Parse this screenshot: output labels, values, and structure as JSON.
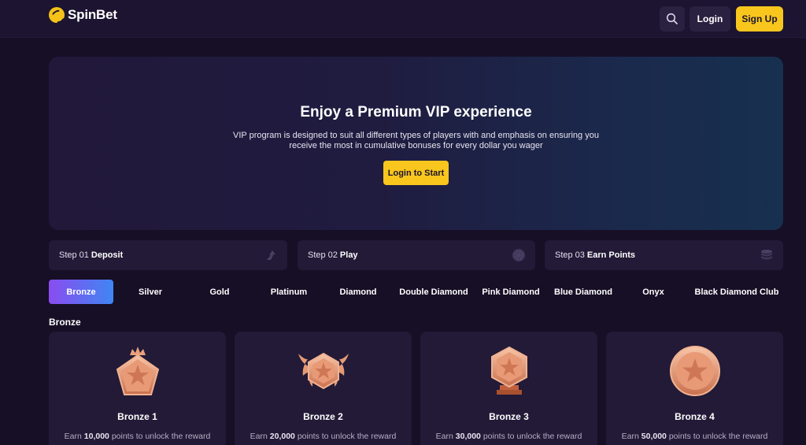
{
  "header": {
    "brand": "SpinBet",
    "login_label": "Login",
    "signup_label": "Sign Up",
    "search_icon": "search-icon"
  },
  "hero": {
    "title": "Enjoy a Premium VIP experience",
    "subtitle_line1": "VIP program is designed to suit all different types of players with and emphasis on ensuring you",
    "subtitle_line2": "receive the most in cumulative bonuses for every dollar you wager",
    "cta_label": "Login to Start"
  },
  "steps": [
    {
      "num": "Step 01",
      "name": "Deposit",
      "icon": "arrow-up-icon"
    },
    {
      "num": "Step 02",
      "name": "Play",
      "icon": "chip-icon"
    },
    {
      "num": "Step 03",
      "name": "Earn Points",
      "icon": "coins-icon"
    }
  ],
  "tiers": [
    "Bronze",
    "Silver",
    "Gold",
    "Platinum",
    "Diamond",
    "Double Diamond",
    "Pink Diamond",
    "Blue Diamond",
    "Onyx",
    "Black Diamond Club"
  ],
  "selected_tier": "Bronze",
  "section_title": "Bronze",
  "cards": [
    {
      "title": "Bronze 1",
      "desc_prefix": "Earn",
      "points": "10,000",
      "desc_suffix": "points to unlock the reward",
      "badge": "pentagon-crown-badge-icon"
    },
    {
      "title": "Bronze 2",
      "desc_prefix": "Earn",
      "points": "20,000",
      "desc_suffix": "points to unlock the reward",
      "badge": "winged-hexagon-badge-icon"
    },
    {
      "title": "Bronze 3",
      "desc_prefix": "Earn",
      "points": "30,000",
      "desc_suffix": "points to unlock the reward",
      "badge": "hexagon-pedestal-badge-icon"
    },
    {
      "title": "Bronze 4",
      "desc_prefix": "Earn",
      "points": "50,000",
      "desc_suffix": "points to unlock the reward",
      "badge": "round-medal-badge-icon"
    }
  ],
  "colors": {
    "background": "#170f26",
    "accent_yellow": "#f8c61c",
    "active_tab_gradient_start": "#8a4cf0",
    "active_tab_gradient_end": "#3f86f3",
    "bronze": "#e08a6a"
  }
}
